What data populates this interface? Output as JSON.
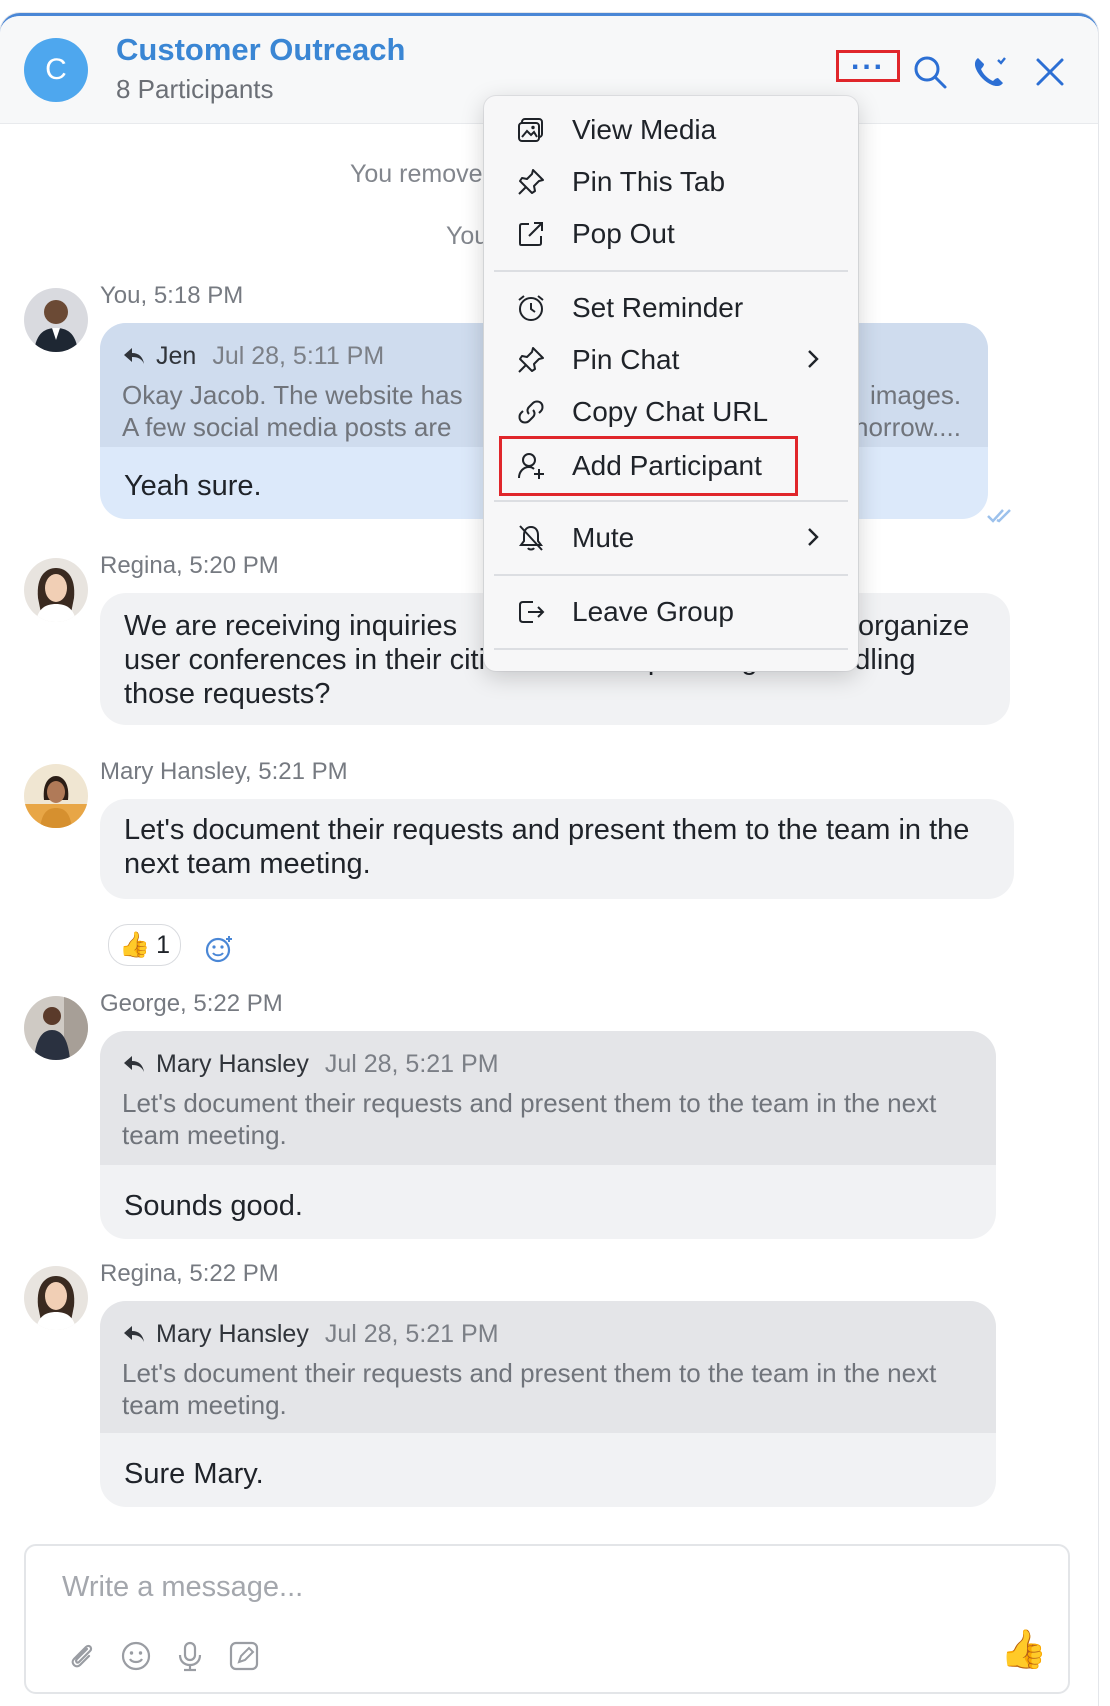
{
  "header": {
    "avatar_letter": "C",
    "title": "Customer Outreach",
    "participants": "8 Participants"
  },
  "system": {
    "line1": "You remove",
    "line2": "You"
  },
  "messages": [
    {
      "meta": "You, 5:18 PM",
      "quote_author": "Jen",
      "quote_date": "Jul 28, 5:11 PM",
      "quote_line1_left": "Okay Jacob. The website has",
      "quote_line1_right": "images.",
      "quote_line2_left": "A few social media posts are",
      "quote_line2_right": "norrow....",
      "text": "Yeah sure."
    },
    {
      "meta": "Regina, 5:20 PM",
      "line1_left": "We are receiving inquiries",
      "line1_right": "organize",
      "line2": "user conferences in their cities. How are planning on handling",
      "line3": "those requests?"
    },
    {
      "meta": "Mary  Hansley, 5:21 PM",
      "text": "Let's document their requests and present them to the team in the next team meeting.",
      "reaction_emoji": "👍",
      "reaction_count": "1"
    },
    {
      "meta": "George, 5:22 PM",
      "quote_author": "Mary  Hansley",
      "quote_date": "Jul 28, 5:21 PM",
      "quote_text": "Let's document their requests and present them to the team in the next team meeting.",
      "text": "Sounds good."
    },
    {
      "meta": "Regina, 5:22 PM",
      "quote_author": "Mary  Hansley",
      "quote_date": "Jul 28, 5:21 PM",
      "quote_text": "Let's document their requests and present them to the team in the next team meeting.",
      "text": "Sure Mary."
    }
  ],
  "menu": {
    "items": [
      {
        "label": "View Media",
        "icon": "media-icon"
      },
      {
        "label": "Pin This Tab",
        "icon": "pin-icon"
      },
      {
        "label": "Pop Out",
        "icon": "popout-icon"
      },
      {
        "label": "Set Reminder",
        "icon": "alarm-icon"
      },
      {
        "label": "Pin Chat",
        "icon": "pin-icon"
      },
      {
        "label": "Copy Chat URL",
        "icon": "link-icon"
      },
      {
        "label": "Add Participant",
        "icon": "add-user-icon"
      },
      {
        "label": "Mute",
        "icon": "mute-icon"
      },
      {
        "label": "Leave Group",
        "icon": "leave-icon"
      }
    ]
  },
  "composer": {
    "placeholder": "Write a message...",
    "send_emoji": "👍"
  },
  "colors": {
    "accent": "#3a86d4",
    "highlight_box": "#e0262b",
    "my_bubble": "#dce9fa",
    "other_bubble": "#f1f2f4"
  }
}
